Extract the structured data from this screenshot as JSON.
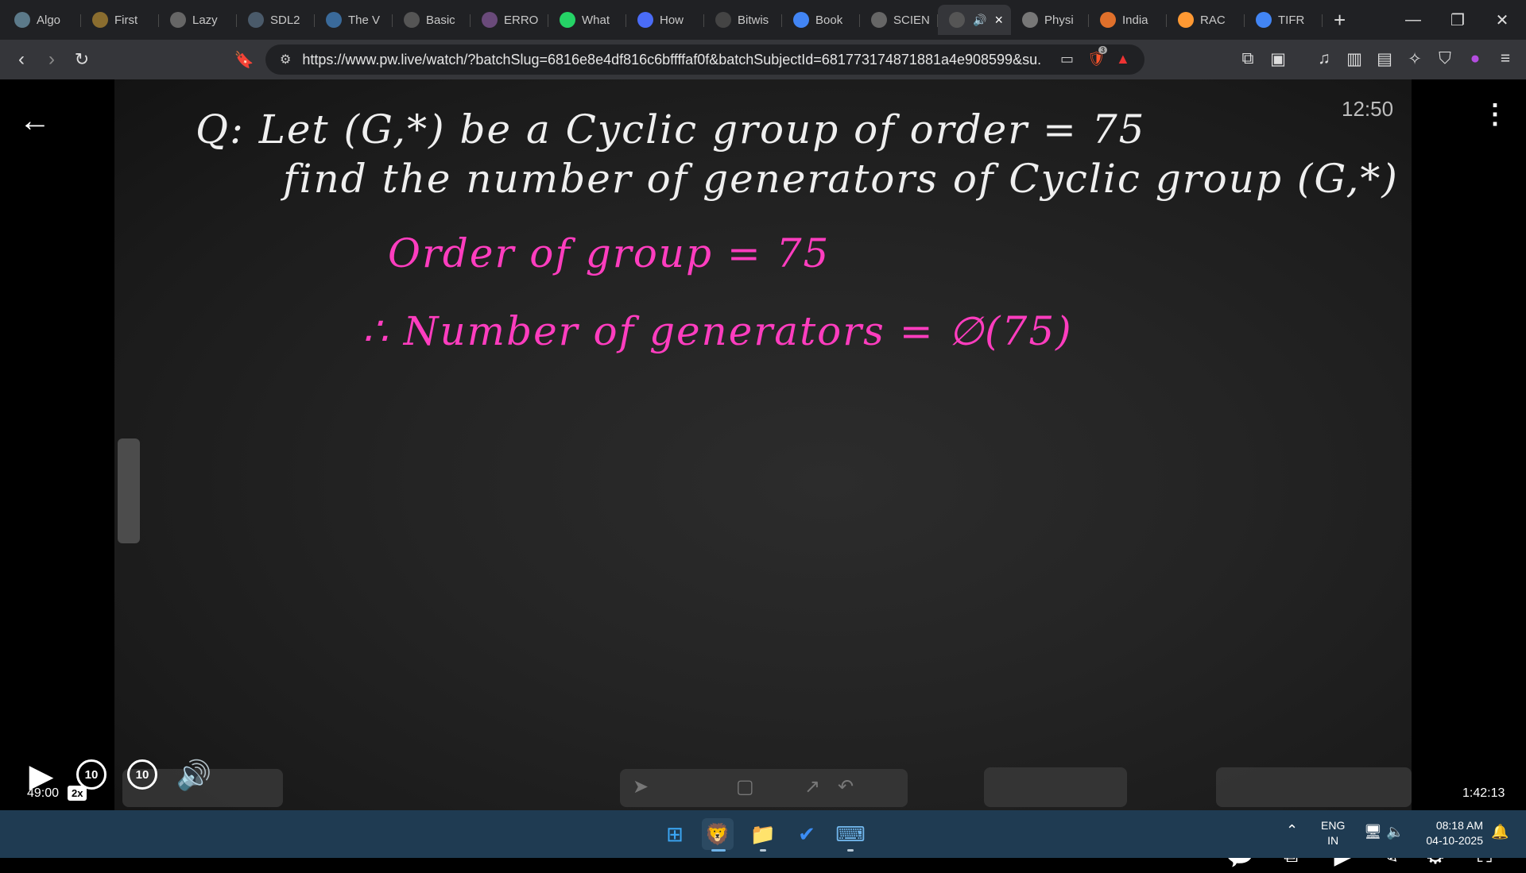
{
  "browser": {
    "tabs": [
      {
        "title": "Algo",
        "icon": "algo-icon",
        "color": "#5c7a8a"
      },
      {
        "title": "First",
        "icon": "bitcoin-icon",
        "color": "#8a6d2f"
      },
      {
        "title": "Lazy",
        "icon": "globe-icon",
        "color": "#666"
      },
      {
        "title": "SDL2",
        "icon": "sdl-icon",
        "color": "#4a5a6a"
      },
      {
        "title": "The V",
        "icon": "wordpress-icon",
        "color": "#3a6a9a"
      },
      {
        "title": "Basic",
        "icon": "site-icon",
        "color": "#555"
      },
      {
        "title": "ERRO",
        "icon": "avatar-icon",
        "color": "#6a4a7a"
      },
      {
        "title": "What",
        "icon": "whatsapp-icon",
        "color": "#25d366"
      },
      {
        "title": "How",
        "icon": "bookmark-icon",
        "color": "#4a6cf7"
      },
      {
        "title": "Bitwis",
        "icon": "code-icon",
        "color": "#444"
      },
      {
        "title": "Book",
        "icon": "google-icon",
        "color": "#4285f4"
      },
      {
        "title": "SCIEN",
        "icon": "globe-icon",
        "color": "#666"
      },
      {
        "title": "",
        "icon": "pw-icon",
        "color": "#555",
        "active": true
      },
      {
        "title": "Physi",
        "icon": "wiki-icon",
        "color": "#777"
      },
      {
        "title": "India",
        "icon": "flag-icon",
        "color": "#e0702b"
      },
      {
        "title": "RAC",
        "icon": "india-flag-icon",
        "color": "#ff9933"
      },
      {
        "title": "TIFR",
        "icon": "google-icon",
        "color": "#4285f4"
      }
    ],
    "new_tab_label": "+",
    "url": "https://www.pw.live/watch/?batchSlug=6816e8e4df816c6bffffaf0f&batchSubjectId=681773174871881a4e908599&su...",
    "brave_shield_count": "3"
  },
  "lecture": {
    "question_line1": "Q: Let (G,*) be a Cyclic group of order = 75",
    "question_line2": "find the number of generators of Cyclic group (G,*)",
    "answer_line1": "Order of group = 75",
    "answer_line2": "∴ Number of generators = ∅(75)",
    "overlay_clock": "12:50"
  },
  "player": {
    "current_time": "49:00",
    "speed": "2x",
    "duration": "1:42:13",
    "progress": 0.4779,
    "rewind_label": "10",
    "forward_label": "10"
  },
  "taskbar": {
    "language_top": "ENG",
    "language_bottom": "IN",
    "time": "08:18 AM",
    "date": "04-10-2025"
  }
}
